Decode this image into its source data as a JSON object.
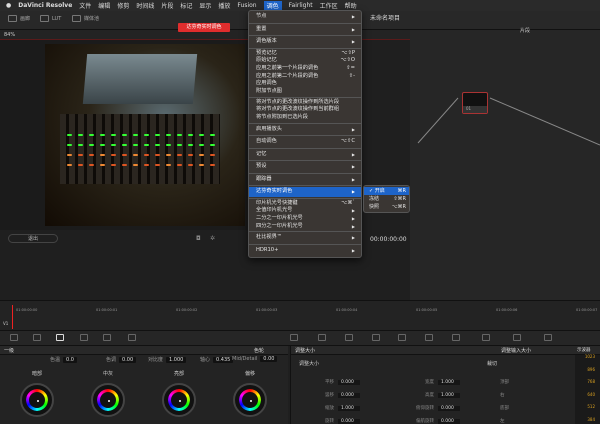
{
  "menubar": {
    "app": "DaVinci Resolve",
    "items": [
      "文件",
      "编辑",
      "修剪",
      "时间线",
      "片段",
      "标记",
      "显示",
      "播放",
      "Fusion",
      "调色",
      "Fairlight",
      "工作区",
      "帮助"
    ]
  },
  "toolbar": {
    "gallery": "画廊",
    "lut": "LUT",
    "media": "媒体池"
  },
  "project_title": "未命名项目",
  "viewer": {
    "zoom": "84%",
    "live_badge": "达芬奇实时调色",
    "exit": "退出",
    "timecode": "00:00:00:00"
  },
  "nodes": {
    "mode": "片段",
    "node_label": "01"
  },
  "color_menu": {
    "groups": [
      [
        {
          "label": "节点",
          "sub": true
        }
      ],
      [
        {
          "label": "重置",
          "sub": true
        }
      ],
      [
        {
          "label": "调色版本",
          "sub": true
        }
      ],
      [
        {
          "label": "预览记忆",
          "sc": "⌥⇧P"
        },
        {
          "label": "原始记忆",
          "sc": "⌥⇧O"
        },
        {
          "label": "应用之前第一个片段的调色",
          "sc": "⇧="
        },
        {
          "label": "应用之前第二个片段的调色",
          "sc": "⇧-"
        },
        {
          "label": "应用调色",
          "sc": ""
        },
        {
          "label": "附加节点图",
          "sc": ""
        }
      ],
      [
        {
          "label": "将对节点的更改波纹操作到所选片段",
          "sc": ""
        },
        {
          "label": "将对节点的更改波纹操作到当前群组",
          "sc": ""
        },
        {
          "label": "将节点附加到已选片段",
          "sc": ""
        }
      ],
      [
        {
          "label": "启用播放头",
          "sub": true
        }
      ],
      [
        {
          "label": "自动调色",
          "sc": "⌥⇧C"
        }
      ],
      [
        {
          "label": "记忆",
          "sub": true
        }
      ],
      [
        {
          "label": "预设",
          "sub": true
        }
      ],
      [
        {
          "label": "跟踪器",
          "sub": true
        }
      ],
      [
        {
          "label": "达芬奇实时调色",
          "sub": true,
          "highlight": true
        }
      ],
      [
        {
          "label": "印片机光号快捷键",
          "sc": "⌥⌘`"
        },
        {
          "label": "全值印片机光号",
          "sub": true
        },
        {
          "label": "二分之一印片机光号",
          "sub": true
        },
        {
          "label": "四分之一印片机光号",
          "sub": true
        }
      ],
      [
        {
          "label": "杜比视界™",
          "sub": true
        }
      ],
      [
        {
          "label": "HDR10+",
          "sub": true
        }
      ]
    ],
    "live_submenu": [
      {
        "label": "✓ 开启",
        "sc": "⌘R"
      },
      {
        "label": "冻结",
        "sc": "⇧⌘R"
      },
      {
        "label": "快照",
        "sc": "⌥⌘R"
      }
    ]
  },
  "timeline": {
    "track": "V1",
    "ticks": [
      "01:00:00:00",
      "01:00:00:01",
      "01:00:00:02",
      "01:00:00:03",
      "01:00:00:04",
      "01:00:00:05",
      "01:00:00:06",
      "01:00:00:07"
    ]
  },
  "primaries": {
    "title": "一级",
    "mode": "色轮",
    "params": [
      {
        "label": "色温",
        "value": "0.0"
      },
      {
        "label": "色调",
        "value": "0.00"
      },
      {
        "label": "对比度",
        "value": "1.000"
      },
      {
        "label": "轴心",
        "value": "0.435"
      },
      {
        "label": "Mid/Detail",
        "value": "0.00"
      }
    ],
    "wheels": [
      "暗部",
      "中灰",
      "亮部",
      "偏移"
    ]
  },
  "resize": {
    "title": "调整大小",
    "mode": "调整输入大小",
    "section": "调整大小",
    "crop": "裁切",
    "left": [
      {
        "label": "平移",
        "value": "0.000"
      },
      {
        "label": "竖移",
        "value": "0.000"
      },
      {
        "label": "缩放",
        "value": "1.000"
      },
      {
        "label": "旋转",
        "value": "0.000"
      }
    ],
    "right": [
      {
        "label": "宽度",
        "value": "1.000"
      },
      {
        "label": "高度",
        "value": "1.000"
      },
      {
        "label": "俯仰旋转",
        "value": "0.000"
      },
      {
        "label": "偏航旋转",
        "value": "0.000"
      }
    ],
    "crop_fields": [
      "顶部",
      "右",
      "底部",
      "左"
    ]
  },
  "scope": {
    "title": "示波器",
    "levels": [
      "1023",
      "896",
      "768",
      "640",
      "512",
      "384"
    ]
  }
}
